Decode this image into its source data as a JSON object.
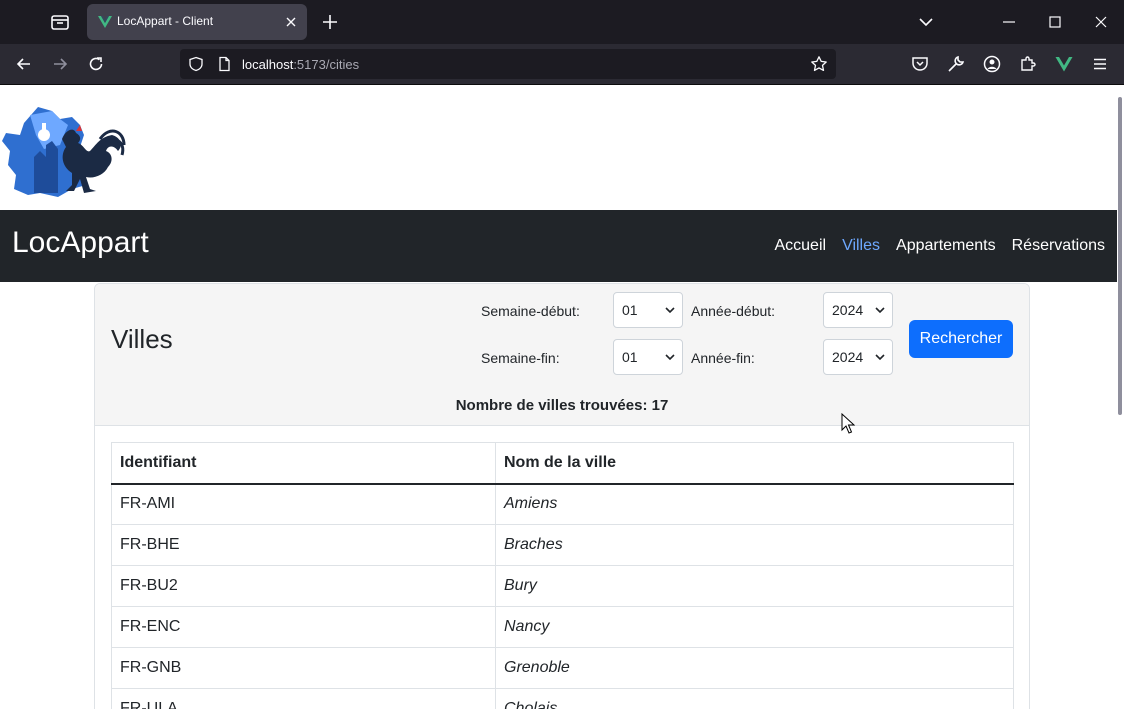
{
  "browser": {
    "tab_title": "LocAppart - Client",
    "url_host": "localhost",
    "url_path": ":5173/cities"
  },
  "site": {
    "brand": "LocAppart",
    "nav": [
      {
        "label": "Accueil",
        "active": false
      },
      {
        "label": "Villes",
        "active": true
      },
      {
        "label": "Appartements",
        "active": false
      },
      {
        "label": "Réservations",
        "active": false
      }
    ]
  },
  "search": {
    "title": "Villes",
    "week_start_label": "Semaine-début:",
    "week_start_value": "01",
    "year_start_label": "Année-début:",
    "year_start_value": "2024",
    "week_end_label": "Semaine-fin:",
    "week_end_value": "01",
    "year_end_label": "Année-fin:",
    "year_end_value": "2024",
    "button": "Rechercher",
    "count_text": "Nombre de villes trouvées: 17"
  },
  "table": {
    "headers": [
      "Identifiant",
      "Nom de la ville"
    ],
    "rows": [
      [
        "FR-AMI",
        "Amiens"
      ],
      [
        "FR-BHE",
        "Braches"
      ],
      [
        "FR-BU2",
        "Bury"
      ],
      [
        "FR-ENC",
        "Nancy"
      ],
      [
        "FR-GNB",
        "Grenoble"
      ],
      [
        "FR-ULA",
        "Cholais"
      ]
    ]
  },
  "colors": {
    "accent": "#0d6efd",
    "nav_bg": "#212529",
    "nav_active": "#6ea8fe"
  }
}
